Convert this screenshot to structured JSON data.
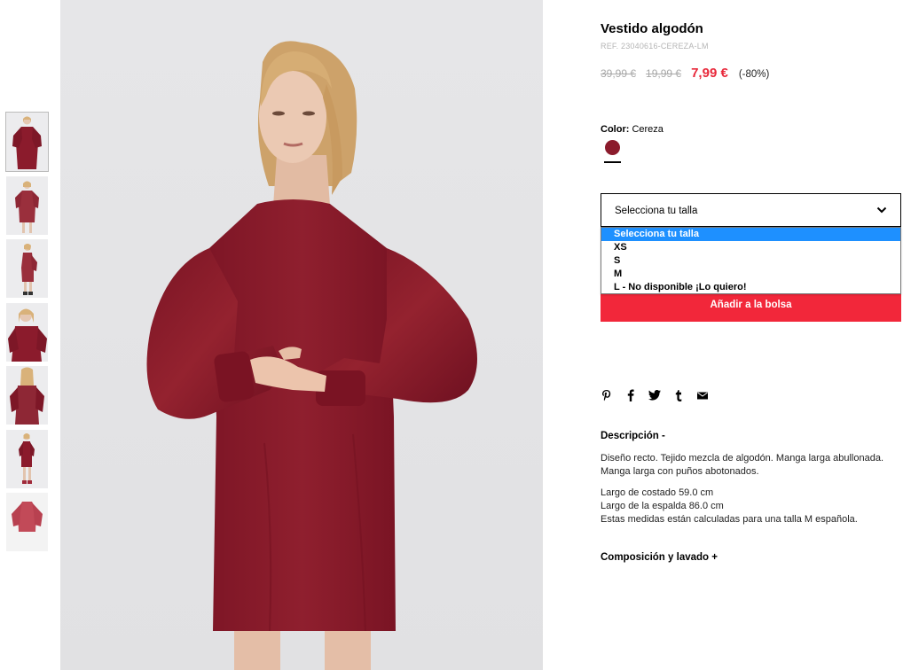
{
  "product": {
    "title": "Vestido algodón",
    "ref": "REF. 23040616-CEREZA-LM",
    "old_price_1": "39,99 €",
    "old_price_2": "19,99 €",
    "price": "7,99 €",
    "discount": "(-80%)"
  },
  "color": {
    "label": "Color:",
    "value": "Cereza",
    "swatch_hex": "#8b1b2c"
  },
  "size": {
    "select_label": "Selecciona tu talla",
    "options": [
      "Selecciona tu talla",
      "XS",
      "S",
      "M",
      "L - No disponible ¡Lo quiero!"
    ]
  },
  "cart": {
    "add_label": "Añadir a la bolsa"
  },
  "share": {
    "icons": [
      "pinterest-icon",
      "facebook-icon",
      "twitter-icon",
      "tumblr-icon",
      "email-icon"
    ]
  },
  "description": {
    "heading": "Descripción -",
    "text": "Diseño recto. Tejido mezcla de algodón. Manga larga abullonada. Manga larga con puños abotonados.",
    "line1": "Largo de costado 59.0 cm",
    "line2": "Largo de la espalda 86.0 cm",
    "line3": "Estas medidas están calculadas para una talla M española."
  },
  "composition": {
    "heading": "Composición y lavado +"
  },
  "colors": {
    "accent": "#f2273a",
    "price_red": "#e8283a",
    "dress": "#8b1b2c",
    "select_highlight": "#1e90ff"
  }
}
